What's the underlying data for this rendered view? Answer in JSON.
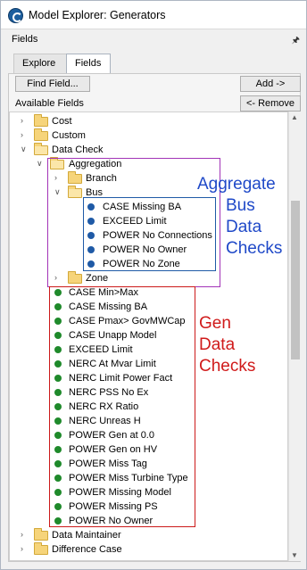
{
  "window": {
    "title": "Model Explorer: Generators"
  },
  "panel": {
    "title": "Fields",
    "pin_icon": "pin-icon"
  },
  "tabs": [
    {
      "label": "Explore",
      "active": false
    },
    {
      "label": "Fields",
      "active": true
    }
  ],
  "toolbar": {
    "find_field": "Find Field...",
    "add": "Add ->",
    "remove": "<- Remove",
    "available_fields": "Available Fields"
  },
  "tree": {
    "cost": "Cost",
    "custom": "Custom",
    "data_check": "Data Check",
    "aggregation": "Aggregation",
    "branch": "Branch",
    "bus": "Bus",
    "bus_items": [
      "CASE Missing BA",
      "EXCEED Limit",
      "POWER No Connections",
      "POWER No Owner",
      "POWER No Zone"
    ],
    "zone": "Zone",
    "gen_items": [
      "CASE Min>Max",
      "CASE Missing BA",
      "CASE Pmax> GovMWCap",
      "CASE Unapp Model",
      "EXCEED Limit",
      "NERC At Mvar Limit",
      "NERC Limit Power Fact",
      "NERC PSS No Ex",
      "NERC RX Ratio",
      "NERC Unreas H",
      "POWER Gen at 0.0",
      "POWER Gen on HV",
      "POWER Miss Tag",
      "POWER Miss Turbine Type",
      "POWER Missing Model",
      "POWER Missing PS",
      "POWER No Owner"
    ],
    "data_maintainer": "Data Maintainer",
    "difference_case": "Difference Case"
  },
  "annotations": {
    "aggregate": [
      "Aggregate",
      "Bus",
      "Data",
      "Checks"
    ],
    "gen": [
      "Gen",
      "Data",
      "Checks"
    ]
  },
  "colors": {
    "aggregate_text": "#1f49c8",
    "gen_text": "#d01a1a",
    "aggregation_box": "#a233b7",
    "bus_box": "#1f5aa6",
    "gen_box": "#cc1a1a",
    "bus_dot": "#1f5aa6",
    "gen_dot": "#1f8a2b"
  }
}
